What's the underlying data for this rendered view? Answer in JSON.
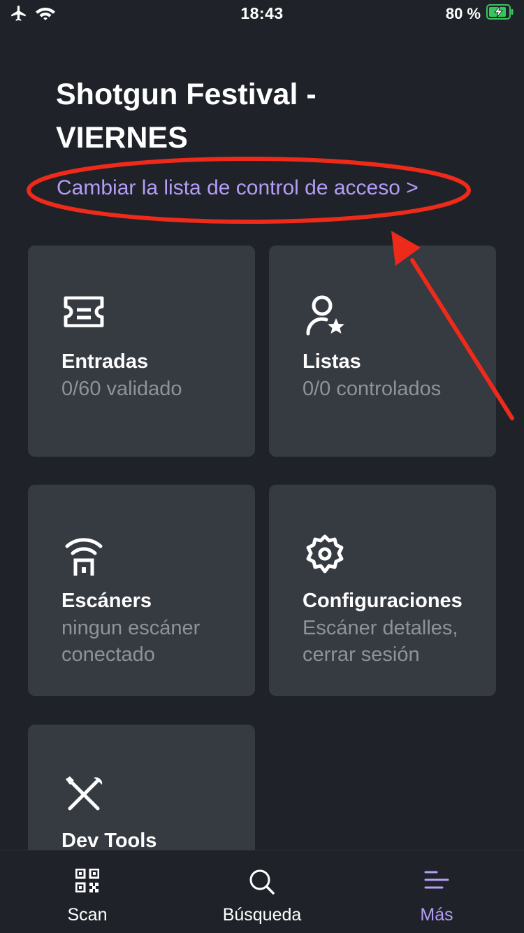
{
  "status_bar": {
    "time": "18:43",
    "battery_percent": "80 %",
    "icons": [
      "airplane-icon",
      "wifi-icon",
      "battery-charging-icon"
    ]
  },
  "header": {
    "title": "Shotgun Festival - VIERNES",
    "access_link": "Cambiar la lista de control de acceso >"
  },
  "cards": [
    {
      "icon": "ticket-icon",
      "title": "Entradas",
      "subtitle": "0/60 validado"
    },
    {
      "icon": "user-star-icon",
      "title": "Listas",
      "subtitle": "0/0 controlados"
    },
    {
      "icon": "scanner-icon",
      "title": "Escáners",
      "subtitle": "ningun escáner conectado"
    },
    {
      "icon": "gear-icon",
      "title": "Configuraciones",
      "subtitle": "Escáner detalles, cerrar sesión"
    },
    {
      "icon": "tools-icon",
      "title": "Dev Tools",
      "subtitle": ""
    }
  ],
  "tab_bar": {
    "tabs": [
      {
        "label": "Scan",
        "icon": "qr-code-icon",
        "active": false
      },
      {
        "label": "Búsqueda",
        "icon": "search-icon",
        "active": false
      },
      {
        "label": "Más",
        "icon": "menu-icon",
        "active": true
      }
    ]
  },
  "colors": {
    "background": "#1f2329",
    "card": "#363a41",
    "accent": "#b49cf7",
    "muted_text": "#8e9299",
    "annotation_red": "#ee2a1a",
    "battery_green": "#35c759"
  }
}
